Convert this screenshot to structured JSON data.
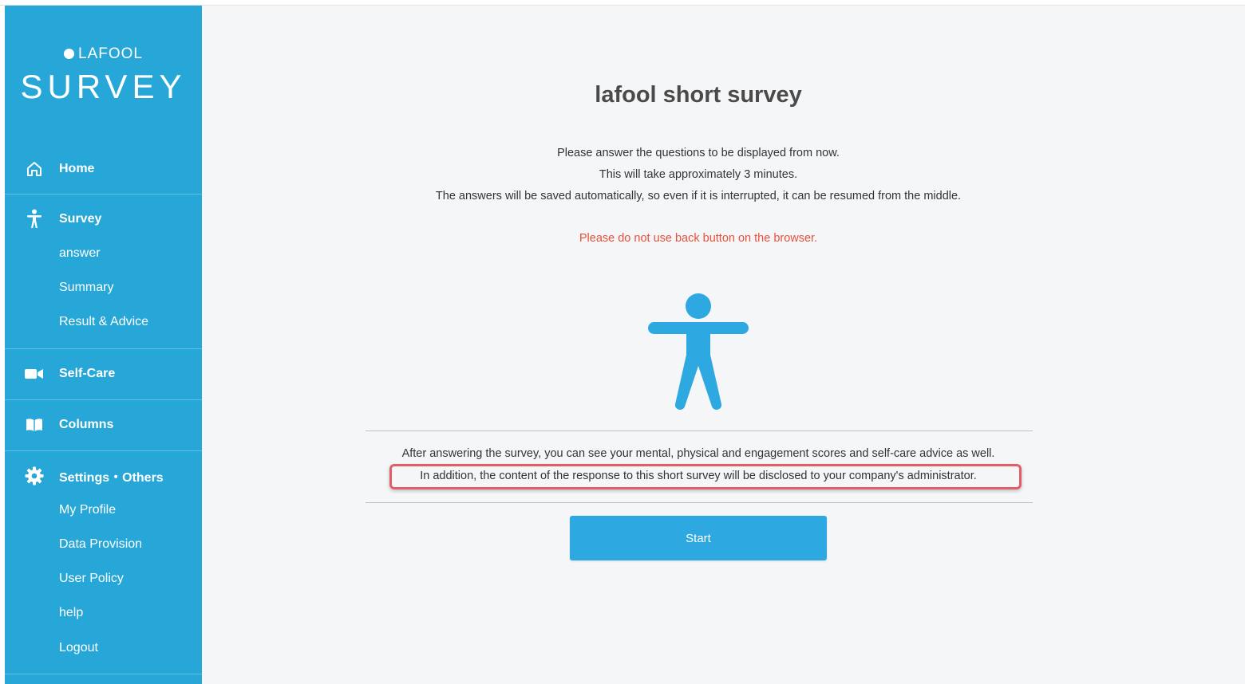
{
  "sidebar": {
    "brand_small": "LAFOOL",
    "brand_big": "SURVEY",
    "nav": {
      "home": "Home",
      "survey": "Survey",
      "survey_sub": [
        "answer",
        "Summary",
        "Result & Advice"
      ],
      "self_care": "Self-Care",
      "columns": "Columns",
      "settings": "Settings・Others",
      "settings_sub": [
        "My Profile",
        "Data Provision",
        "User Policy",
        "help",
        "Logout"
      ]
    }
  },
  "main": {
    "title": "lafool short survey",
    "intro": [
      "Please answer the questions to be displayed from now.",
      "This will take approximately 3 minutes.",
      "The answers will be saved automatically, so even if it is interrupted, it can be resumed from the middle."
    ],
    "warning": "Please do not use back button on the browser.",
    "note_1": "After answering the survey, you can see your mental, physical and engagement scores and self-care advice as well.",
    "note_2": "In addition, the content of the response to this short survey will be disclosed to your company's administrator.",
    "start_label": "Start"
  },
  "colors": {
    "sidebar": "#27a7d8",
    "accent": "#2da8e0",
    "warning": "#ea4f3a",
    "highlight": "#e35c69"
  },
  "icons": [
    "home-icon",
    "person-icon",
    "video-camera-icon",
    "book-icon",
    "gear-icon"
  ]
}
